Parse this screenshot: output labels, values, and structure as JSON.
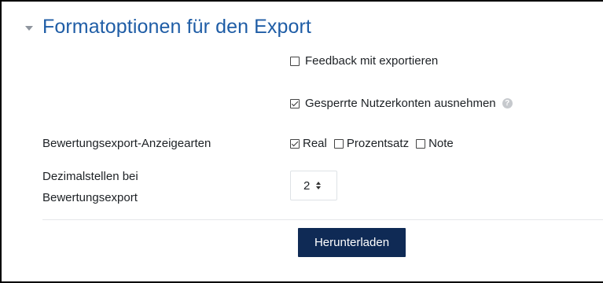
{
  "fieldset": {
    "title": "Formatoptionen für den Export"
  },
  "options": {
    "feedback": {
      "label": "Feedback mit exportieren",
      "checked": false
    },
    "suspended": {
      "label": "Gesperrte Nutzerkonten ausnehmen",
      "checked": true,
      "help_icon": "question-circle-icon"
    }
  },
  "display_types": {
    "label": "Bewertungsexport-Anzeigearten",
    "items": [
      {
        "label": "Real",
        "checked": true
      },
      {
        "label": "Prozentsatz",
        "checked": false
      },
      {
        "label": "Note",
        "checked": false
      }
    ]
  },
  "decimals": {
    "label_line1": "Dezimalstellen bei",
    "label_line2": "Bewertungsexport",
    "value": "2"
  },
  "actions": {
    "download_label": "Herunterladen"
  },
  "colors": {
    "title": "#1f5da6",
    "button_bg": "#0f2a55"
  }
}
